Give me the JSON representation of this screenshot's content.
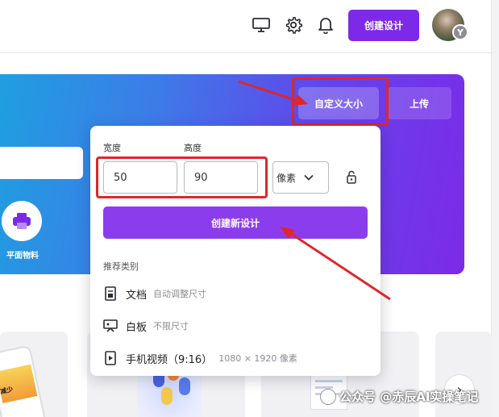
{
  "topbar": {
    "icons": [
      "desktop-icon",
      "gear-icon",
      "bell-icon"
    ],
    "create_design_label": "创建设计",
    "avatar_badge": "Y"
  },
  "banner": {
    "tabs": [
      {
        "label": "自定义大小",
        "active": true
      },
      {
        "label": "上传",
        "active": false
      }
    ],
    "category_label": "平面物料"
  },
  "popover": {
    "width_label": "宽度",
    "height_label": "高度",
    "width_value": "50",
    "height_value": "90",
    "unit": "像素",
    "create_button": "创建新设计",
    "section_title": "推荐类别",
    "categories": [
      {
        "label": "文档",
        "sub": "自动调整尺寸",
        "icon": "document-icon"
      },
      {
        "label": "白板",
        "sub": "不限尺寸",
        "icon": "whiteboard-icon"
      },
      {
        "label": "手机视频（9:16）",
        "sub": "1080 × 1920 像素",
        "icon": "video-icon"
      }
    ]
  },
  "templates": {
    "phone_text": "减少"
  },
  "watermark": "公众号 @赤辰AI实操笔记",
  "colors": {
    "accent": "#7d2ae8",
    "annotation_red": "#e0262b"
  }
}
